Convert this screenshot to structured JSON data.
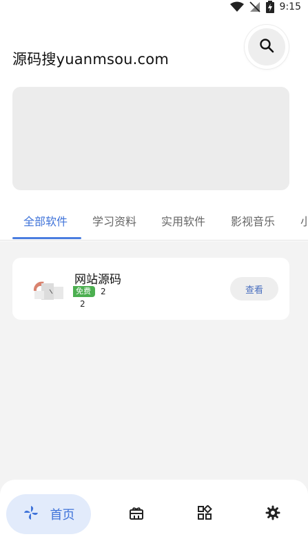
{
  "status_bar": {
    "time": "9:15"
  },
  "header": {
    "title": "源码搜yuanmsou.com"
  },
  "tabs": [
    {
      "label": "全部软件",
      "active": true
    },
    {
      "label": "学习资料",
      "active": false
    },
    {
      "label": "实用软件",
      "active": false
    },
    {
      "label": "影视音乐",
      "active": false
    },
    {
      "label": "小",
      "active": false
    }
  ],
  "list": [
    {
      "title": "网站源码",
      "badge": "免费",
      "count": "2",
      "count2": "2",
      "action_label": "查看"
    }
  ],
  "bottom_nav": {
    "home_label": "首页",
    "icons": [
      "pinwheel-icon",
      "gift-icon",
      "apps-icon",
      "settings-icon"
    ]
  },
  "colors": {
    "accent": "#3f73d9",
    "badge_green": "#4caf50",
    "home_pill": "#e2ebfb"
  }
}
